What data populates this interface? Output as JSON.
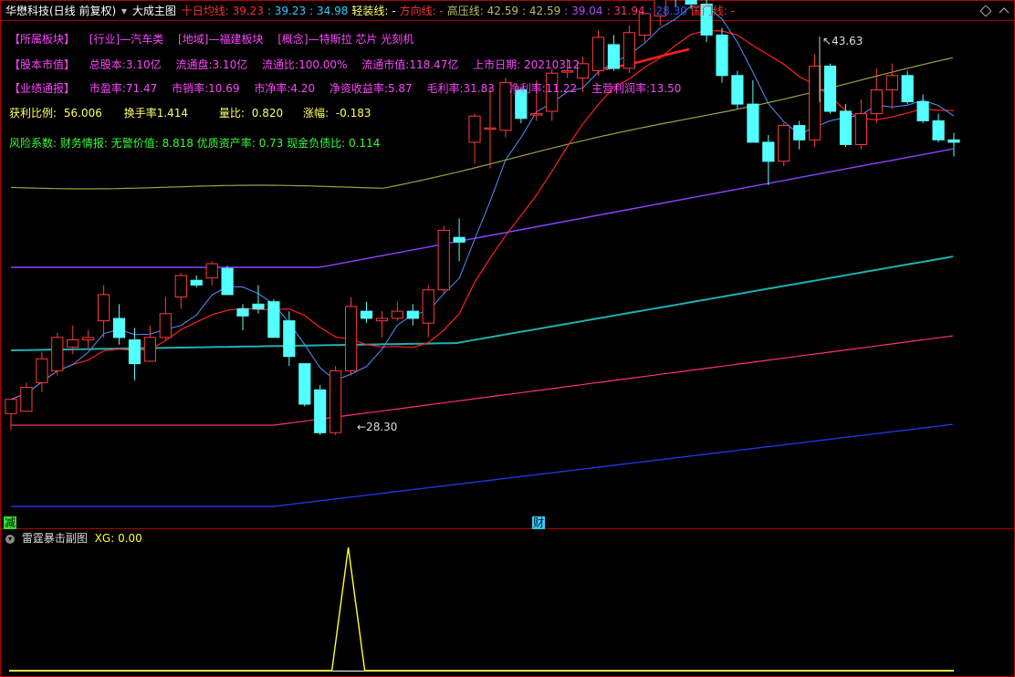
{
  "header": {
    "stock_name": "华懋科技(日线 前复权)",
    "indicator_name": "大成主图",
    "items": [
      {
        "label": "十日均线:",
        "value": "39.23",
        "color": "#ff3030"
      },
      {
        "label": ":",
        "value": "39.23",
        "color": "#33ccff"
      },
      {
        "label": ":",
        "value": "34.98",
        "color": "#33ccff"
      },
      {
        "label": "轻装线:",
        "value": "-",
        "color": "#ffff66"
      },
      {
        "label": "方向线:",
        "value": "-",
        "color": "#ff3030"
      },
      {
        "label": "高压线:",
        "value": "42.59",
        "color": "#bbbb66"
      },
      {
        "label": ":",
        "value": "42.59",
        "color": "#bbbb66"
      },
      {
        "label": ":",
        "value": "39.04",
        "color": "#bb44ff"
      },
      {
        "label": ":",
        "value": "31.94",
        "color": "#ff3070"
      },
      {
        "label": ":",
        "value": "28.30",
        "color": "#3355ff"
      },
      {
        "label": "国门线:",
        "value": "-",
        "color": "#ff3030"
      }
    ]
  },
  "info_rows": {
    "row1": [
      "【所属板块】",
      "[行业]—汽车类",
      "[地域]—福建板块",
      "[概念]—特斯拉 芯片 光刻机"
    ],
    "row2": [
      "【股本市值】",
      "总股本:3.10亿",
      "流通盘:3.10亿",
      "流通比:100.00%",
      "流通市值:118.47亿",
      "上市日期: 20210312"
    ],
    "row3": [
      "【业绩通报】",
      "市盈率:71.47",
      "市销率:10.69",
      "市净率:4.20",
      "净资收益率:5.87",
      "毛利率:31.83",
      "净利率:11.22",
      "主营利润率:13.50"
    ],
    "row4": [
      "获利比例:",
      "56.006",
      "换手率1.414",
      "量比:",
      "0.820",
      "涨幅:",
      "-0.183"
    ],
    "row5": "风险系数: 财务情报: 无警价值: 8.818 优质资产率: 0.73 现金负债比: 0.114"
  },
  "markers": {
    "high_label": "43.63",
    "low_label": "28.30",
    "bottom_left": "减",
    "bottom_mid": "财"
  },
  "sub_panel": {
    "name": "雷霆暴击副图",
    "label": "XG:",
    "value": "0.00"
  },
  "colors": {
    "up": "#ff3b3b",
    "down": "#54ffff",
    "border": "#b00000",
    "ma10": "#ff2020",
    "ma_blue": "#5090ff",
    "ma_teal": "#20b0b0",
    "ma_olive": "#a0a040",
    "ma_purple": "#8844ff",
    "ma_pink": "#ff3070",
    "ma_navy": "#2233dd",
    "xg_line": "#ffff33"
  },
  "chart_data": {
    "type": "candlestick",
    "ylim": [
      24.5,
      45.5
    ],
    "candles": [
      {
        "o": 29.2,
        "h": 29.8,
        "l": 28.5,
        "c": 29.8
      },
      {
        "o": 29.3,
        "h": 30.5,
        "l": 29.3,
        "c": 30.3
      },
      {
        "o": 30.5,
        "h": 31.8,
        "l": 30.1,
        "c": 31.5
      },
      {
        "o": 31.0,
        "h": 32.6,
        "l": 30.8,
        "c": 32.4
      },
      {
        "o": 32.0,
        "h": 32.9,
        "l": 31.7,
        "c": 32.3
      },
      {
        "o": 32.3,
        "h": 32.7,
        "l": 31.9,
        "c": 32.4
      },
      {
        "o": 33.1,
        "h": 34.6,
        "l": 32.4,
        "c": 34.2
      },
      {
        "o": 33.2,
        "h": 33.8,
        "l": 32.1,
        "c": 32.4
      },
      {
        "o": 32.3,
        "h": 32.8,
        "l": 30.6,
        "c": 31.3
      },
      {
        "o": 31.4,
        "h": 32.9,
        "l": 31.4,
        "c": 32.4
      },
      {
        "o": 32.4,
        "h": 34.1,
        "l": 32.3,
        "c": 33.4
      },
      {
        "o": 34.1,
        "h": 35.1,
        "l": 33.6,
        "c": 35.0
      },
      {
        "o": 34.8,
        "h": 35.0,
        "l": 34.5,
        "c": 34.6
      },
      {
        "o": 34.9,
        "h": 35.6,
        "l": 34.6,
        "c": 35.5
      },
      {
        "o": 35.3,
        "h": 35.4,
        "l": 34.2,
        "c": 34.2
      },
      {
        "o": 33.6,
        "h": 33.8,
        "l": 32.7,
        "c": 33.3
      },
      {
        "o": 33.8,
        "h": 34.6,
        "l": 33.4,
        "c": 33.6
      },
      {
        "o": 33.9,
        "h": 34.0,
        "l": 32.4,
        "c": 32.4
      },
      {
        "o": 33.1,
        "h": 33.5,
        "l": 31.2,
        "c": 31.6
      },
      {
        "o": 31.3,
        "h": 31.3,
        "l": 29.5,
        "c": 29.6
      },
      {
        "o": 30.2,
        "h": 30.4,
        "l": 28.3,
        "c": 28.4
      },
      {
        "o": 28.4,
        "h": 31.2,
        "l": 28.3,
        "c": 31.0
      },
      {
        "o": 31.0,
        "h": 34.1,
        "l": 30.8,
        "c": 33.7
      },
      {
        "o": 33.5,
        "h": 33.9,
        "l": 33.0,
        "c": 33.2
      },
      {
        "o": 33.1,
        "h": 33.5,
        "l": 32.4,
        "c": 33.2
      },
      {
        "o": 33.2,
        "h": 33.9,
        "l": 33.1,
        "c": 33.5
      },
      {
        "o": 33.5,
        "h": 33.8,
        "l": 32.9,
        "c": 33.2
      },
      {
        "o": 33.0,
        "h": 34.6,
        "l": 32.4,
        "c": 34.4
      },
      {
        "o": 34.4,
        "h": 37.1,
        "l": 34.2,
        "c": 36.9
      },
      {
        "o": 36.6,
        "h": 37.4,
        "l": 35.6,
        "c": 36.4
      },
      {
        "o": 40.6,
        "h": 41.8,
        "l": 39.7,
        "c": 41.7
      },
      {
        "o": 41.2,
        "h": 42.9,
        "l": 39.5,
        "c": 41.2
      },
      {
        "o": 41.1,
        "h": 43.3,
        "l": 40.8,
        "c": 43.1
      },
      {
        "o": 42.8,
        "h": 42.9,
        "l": 41.4,
        "c": 41.6
      },
      {
        "o": 41.8,
        "h": 43.2,
        "l": 41.5,
        "c": 41.8
      },
      {
        "o": 41.9,
        "h": 43.7,
        "l": 41.5,
        "c": 43.5
      },
      {
        "o": 43.6,
        "h": 44.1,
        "l": 43.3,
        "c": 43.6
      },
      {
        "o": 43.3,
        "h": 44.2,
        "l": 42.7,
        "c": 43.9
      },
      {
        "o": 43.6,
        "h": 45.3,
        "l": 43.4,
        "c": 45.0
      },
      {
        "o": 44.7,
        "h": 45.1,
        "l": 43.6,
        "c": 43.7
      },
      {
        "o": 43.7,
        "h": 45.5,
        "l": 43.5,
        "c": 45.2
      },
      {
        "o": 45.1,
        "h": 46.0,
        "l": 44.8,
        "c": 46.0
      },
      {
        "o": 45.9,
        "h": 47.2,
        "l": 45.5,
        "c": 47.1
      },
      {
        "o": 47.1,
        "h": 48.1,
        "l": 46.3,
        "c": 46.9
      },
      {
        "o": 46.9,
        "h": 47.1,
        "l": 46.2,
        "c": 46.4
      },
      {
        "o": 46.4,
        "h": 46.8,
        "l": 44.8,
        "c": 45.1
      },
      {
        "o": 45.1,
        "h": 45.4,
        "l": 43.1,
        "c": 43.4
      },
      {
        "o": 43.4,
        "h": 43.6,
        "l": 42.0,
        "c": 42.2
      },
      {
        "o": 42.2,
        "h": 43.2,
        "l": 40.9,
        "c": 40.6
      },
      {
        "o": 40.6,
        "h": 40.9,
        "l": 38.8,
        "c": 39.8
      },
      {
        "o": 39.8,
        "h": 41.4,
        "l": 39.6,
        "c": 41.3
      },
      {
        "o": 41.3,
        "h": 41.5,
        "l": 40.3,
        "c": 40.7
      },
      {
        "o": 40.7,
        "h": 44.3,
        "l": 40.4,
        "c": 43.8
      },
      {
        "o": 43.8,
        "h": 43.9,
        "l": 41.8,
        "c": 41.9
      },
      {
        "o": 41.9,
        "h": 42.2,
        "l": 40.4,
        "c": 40.5
      },
      {
        "o": 40.5,
        "h": 42.4,
        "l": 40.3,
        "c": 41.8
      },
      {
        "o": 41.8,
        "h": 43.7,
        "l": 41.4,
        "c": 42.8
      },
      {
        "o": 42.8,
        "h": 43.9,
        "l": 42.0,
        "c": 43.4
      },
      {
        "o": 43.4,
        "h": 43.6,
        "l": 42.2,
        "c": 42.3
      },
      {
        "o": 42.3,
        "h": 42.6,
        "l": 41.4,
        "c": 41.5
      },
      {
        "o": 41.5,
        "h": 41.8,
        "l": 40.6,
        "c": 40.7
      },
      {
        "o": 40.7,
        "h": 41.0,
        "l": 40.0,
        "c": 40.6
      }
    ],
    "xg_pulse_index": 21,
    "high_value": 43.63,
    "low_value": 28.3
  }
}
